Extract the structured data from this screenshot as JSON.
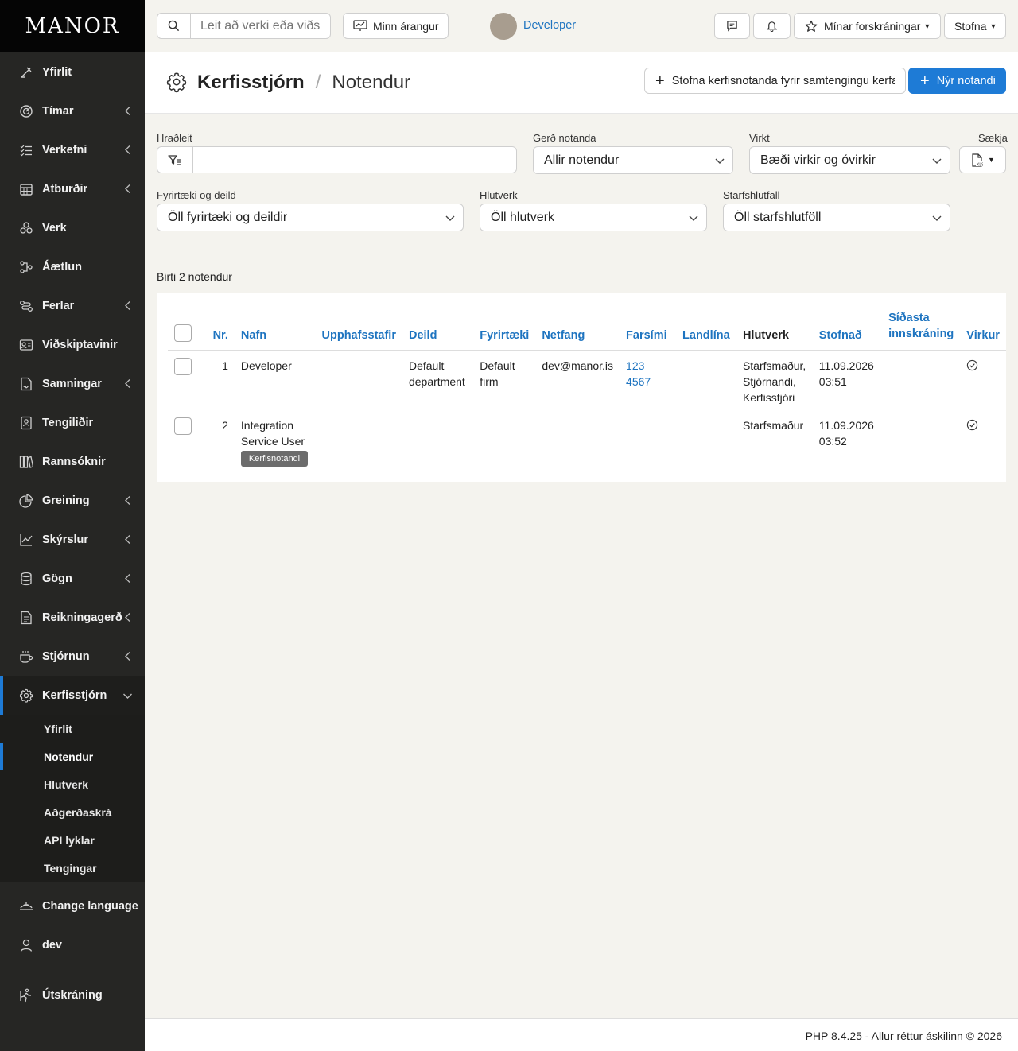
{
  "brand": "MANOR",
  "sidebar": {
    "items": [
      {
        "label": "Yfirlit",
        "icon": "dashboard-icon",
        "has_children": false
      },
      {
        "label": "Tímar",
        "icon": "target-clock-icon",
        "has_children": true
      },
      {
        "label": "Verkefni",
        "icon": "checklist-icon",
        "has_children": true
      },
      {
        "label": "Atburðir",
        "icon": "calendar-icon",
        "has_children": true
      },
      {
        "label": "Verk",
        "icon": "project-icon",
        "has_children": false
      },
      {
        "label": "Áætlun",
        "icon": "plan-icon",
        "has_children": false
      },
      {
        "label": "Ferlar",
        "icon": "process-icon",
        "has_children": true
      },
      {
        "label": "Viðskiptavinir",
        "icon": "client-card-icon",
        "has_children": false
      },
      {
        "label": "Samningar",
        "icon": "contract-icon",
        "has_children": true
      },
      {
        "label": "Tengiliðir",
        "icon": "contact-icon",
        "has_children": false
      },
      {
        "label": "Rannsóknir",
        "icon": "books-icon",
        "has_children": false
      },
      {
        "label": "Greining",
        "icon": "pie-chart-icon",
        "has_children": true
      },
      {
        "label": "Skýrslur",
        "icon": "line-chart-icon",
        "has_children": true
      },
      {
        "label": "Gögn",
        "icon": "database-icon",
        "has_children": true
      },
      {
        "label": "Reikningagerð",
        "icon": "invoice-icon",
        "has_children": true
      },
      {
        "label": "Stjórnun",
        "icon": "coffee-icon",
        "has_children": true
      },
      {
        "label": "Kerfisstjórn",
        "icon": "gear-icon",
        "has_children": true
      }
    ],
    "sub_items": [
      "Yfirlit",
      "Notendur",
      "Hlutverk",
      "Aðgerðaskrá",
      "API lyklar",
      "Tengingar"
    ],
    "current_sub": "Notendur",
    "bottom": [
      {
        "label": "Change language",
        "icon": "language-icon"
      },
      {
        "label": "dev",
        "icon": "user-icon"
      },
      {
        "label": "Útskráning",
        "icon": "logout-icon"
      }
    ]
  },
  "topbar": {
    "search_placeholder": "Leit að verki eða viðskiptavini",
    "performance_label": "Minn árangur",
    "user_name": "Developer",
    "favorites_label": "Mínar forskráningar",
    "create_label": "Stofna"
  },
  "header": {
    "section": "Kerfisstjórn",
    "separator": "/",
    "page": "Notendur",
    "create_system_user_label": "Stofna kerfisnotanda fyrir samtengingu kerfa",
    "new_user_label": "Nýr notandi"
  },
  "filters": {
    "quick_search_label": "Hraðleit",
    "quick_search_value": "",
    "user_type_label": "Gerð notanda",
    "user_type_value": "Allir notendur",
    "active_label": "Virkt",
    "active_value": "Bæði virkir og óvirkir",
    "download_label": "Sækja",
    "company_label": "Fyrirtæki og deild",
    "company_value": "Öll fyrirtæki og deildir",
    "role_label": "Hlutverk",
    "role_value": "Öll hlutverk",
    "ratio_label": "Starfshlutfall",
    "ratio_value": "Öll starfshlutföll"
  },
  "results_text": "Birti 2 notendur",
  "table": {
    "columns": [
      "Nr.",
      "Nafn",
      "Upphafsstafir",
      "Deild",
      "Fyrirtæki",
      "Netfang",
      "Farsími",
      "Landlína",
      "Hlutverk",
      "Stofnað",
      "Síðasta innskráning",
      "Virkur"
    ],
    "rows": [
      {
        "nr": "1",
        "name": "Developer",
        "badge": "",
        "initials": "",
        "department": "Default department",
        "company": "Default firm",
        "email": "dev@manor.is",
        "mobile": "123 4567",
        "landline": "",
        "roles": "Starfsmaður, Stjórnandi, Kerfisstjóri",
        "created": "11.09.2026 03:51",
        "last_login": "",
        "active": true
      },
      {
        "nr": "2",
        "name": "Integration Service User",
        "badge": "Kerfisnotandi",
        "initials": "",
        "department": "",
        "company": "",
        "email": "",
        "mobile": "",
        "landline": "",
        "roles": "Starfsmaður",
        "created": "11.09.2026 03:52",
        "last_login": "",
        "active": true
      }
    ]
  },
  "footer": "PHP 8.4.25 - Allur réttur áskilinn © 2026",
  "colors": {
    "accent": "#1e7bd6",
    "sidebar": "#262624",
    "link": "#1e74c0"
  }
}
